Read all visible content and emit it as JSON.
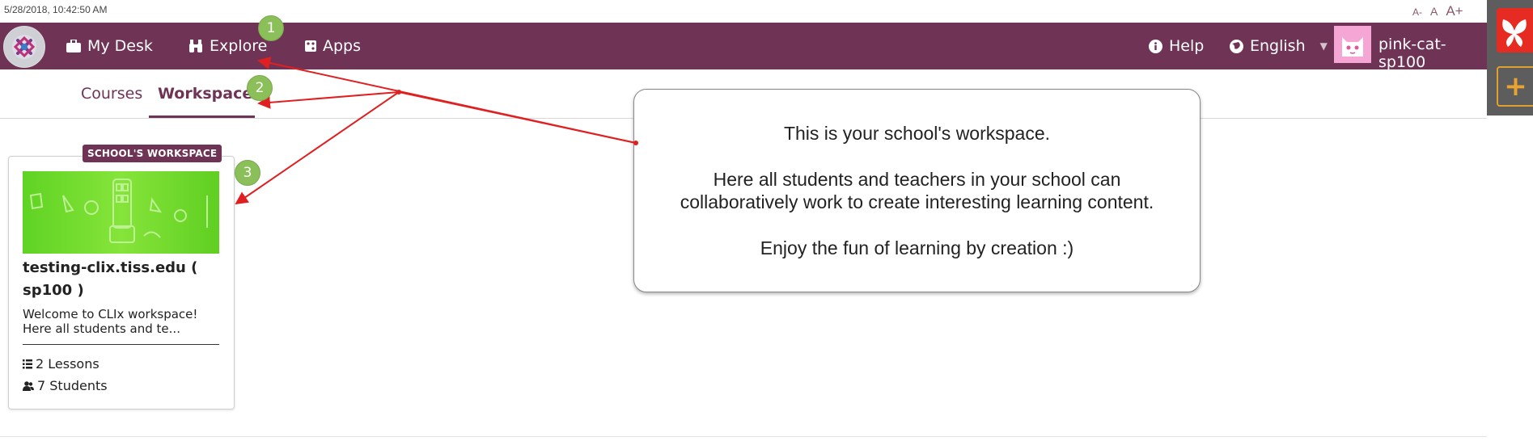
{
  "timestamp": "5/28/2018, 10:42:50 AM",
  "font_size_controls": [
    "A-",
    "A",
    "A+"
  ],
  "nav": {
    "my_desk": "My Desk",
    "explore": "Explore",
    "apps": "Apps",
    "help": "Help",
    "language": "English",
    "username": "pink-cat-sp100"
  },
  "tabs": {
    "courses": "Courses",
    "workspaces": "Workspaces"
  },
  "card": {
    "badge": "SCHOOL'S WORKSPACE",
    "title": "testing-clix.tiss.edu ( sp100 )",
    "description_line1": "Welcome to CLIx workspace!",
    "description_line2": "Here all students and te...",
    "lessons": "2 Lessons",
    "students": "7 Students"
  },
  "tooltip": {
    "line1": "This is your school's workspace.",
    "line2": "Here all students and teachers in your school can",
    "line3": "collaboratively work to create interesting learning content.",
    "line4": "Enjoy the fun of learning by creation :)"
  },
  "step_badges": [
    "1",
    "2",
    "3"
  ],
  "colors": {
    "brand": "#6f3355",
    "step_badge": "#8bbf5a",
    "arrow": "#e02020",
    "thumbnail_green": "#6fd82a"
  }
}
